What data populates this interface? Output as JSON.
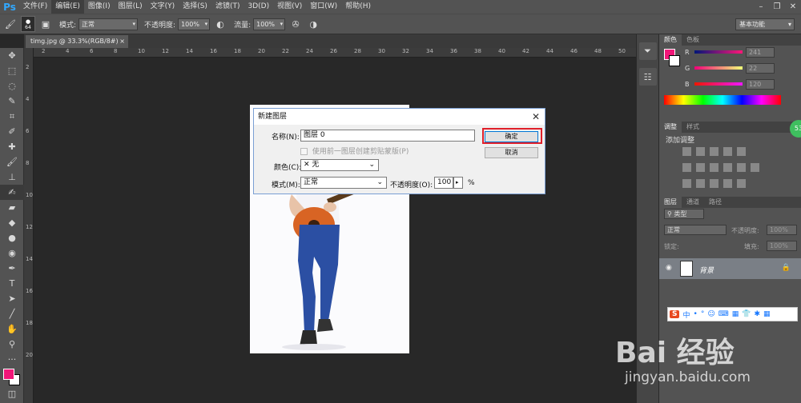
{
  "app": {
    "logo": "Ps"
  },
  "menu": [
    "文件(F)",
    "编辑(E)",
    "图像(I)",
    "图层(L)",
    "文字(Y)",
    "选择(S)",
    "滤镜(T)",
    "3D(D)",
    "视图(V)",
    "窗口(W)",
    "帮助(H)"
  ],
  "window_controls": {
    "minimize": "–",
    "restore": "❐",
    "close": "✕"
  },
  "options_bar": {
    "brush_size": "64",
    "mode_label": "模式:",
    "mode_value": "正常",
    "opacity_label": "不透明度:",
    "opacity_value": "100%",
    "flow_label": "流量:",
    "flow_value": "100%",
    "workspace": "基本功能"
  },
  "document_tab": {
    "title": "timg.jpg @ 33.3%(RGB/8#)",
    "close": "×"
  },
  "ruler": {
    "top": [
      "2",
      "4",
      "6",
      "8",
      "10",
      "12",
      "14",
      "16",
      "18",
      "20",
      "22",
      "24",
      "26",
      "28",
      "30",
      "32",
      "34",
      "36",
      "38",
      "40",
      "42",
      "44",
      "46",
      "48",
      "50"
    ],
    "left": [
      "2",
      "4",
      "6",
      "8",
      "10",
      "12",
      "14",
      "16",
      "18",
      "20"
    ]
  },
  "dialog": {
    "title": "新建图层",
    "close": "✕",
    "name_label": "名称(N):",
    "name_value": "图层 0",
    "clip_checkbox": "使用前一图层创建剪贴蒙版(P)",
    "color_label": "颜色(C):",
    "color_value": "无",
    "color_icon": "✕",
    "mode_label": "模式(M):",
    "mode_value": "正常",
    "opacity_label": "不透明度(O):",
    "opacity_value": "100",
    "opacity_unit": "%",
    "ok_button": "确定",
    "cancel_button": "取消"
  },
  "color_panel": {
    "tabs": [
      "颜色",
      "色板"
    ],
    "r_label": "R",
    "r_value": "241",
    "g_label": "G",
    "g_value": "22",
    "b_label": "B",
    "b_value": "120",
    "foreground": "#f11678"
  },
  "adjust_panel": {
    "tabs": [
      "调整",
      "样式"
    ],
    "subtitle": "添加调整"
  },
  "layers_panel": {
    "tabs": [
      "图层",
      "通道",
      "路径"
    ],
    "filter": "类型",
    "mode": "正常",
    "opacity_label": "不透明度:",
    "opacity_value": "100%",
    "lock_label": "锁定:",
    "fill_label": "填充:",
    "fill_value": "100%",
    "layer_name": "背景"
  },
  "ime_bar": {
    "logo": "S",
    "items": [
      "中",
      "•",
      "°",
      "☺",
      "⌨",
      "▦",
      "👕",
      "✱",
      "▦"
    ]
  },
  "badge": "53",
  "watermark": {
    "brand": "Bai 经验",
    "url": "jingyan.baidu.com"
  }
}
